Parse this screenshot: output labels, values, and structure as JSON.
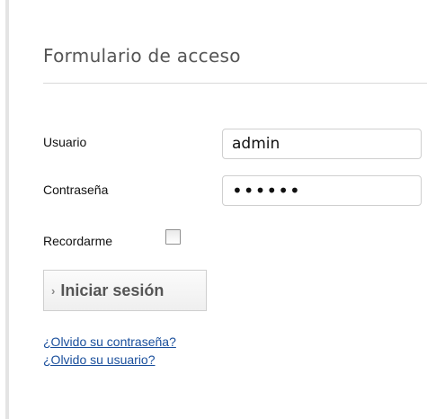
{
  "form": {
    "title": "Formulario de acceso",
    "username_label": "Usuario",
    "username_value": "admin",
    "password_label": "Contraseña",
    "password_value": "••••••",
    "remember_label": "Recordarme",
    "remember_checked": false,
    "submit_chevron": "›",
    "submit_label": "Iniciar sesión"
  },
  "links": {
    "forgot_password": "¿Olvido su contraseña?",
    "forgot_username": "¿Olvido su usuario?"
  },
  "colors": {
    "link": "#1a4f9c",
    "title": "#555555",
    "border": "#cfcfcf"
  }
}
